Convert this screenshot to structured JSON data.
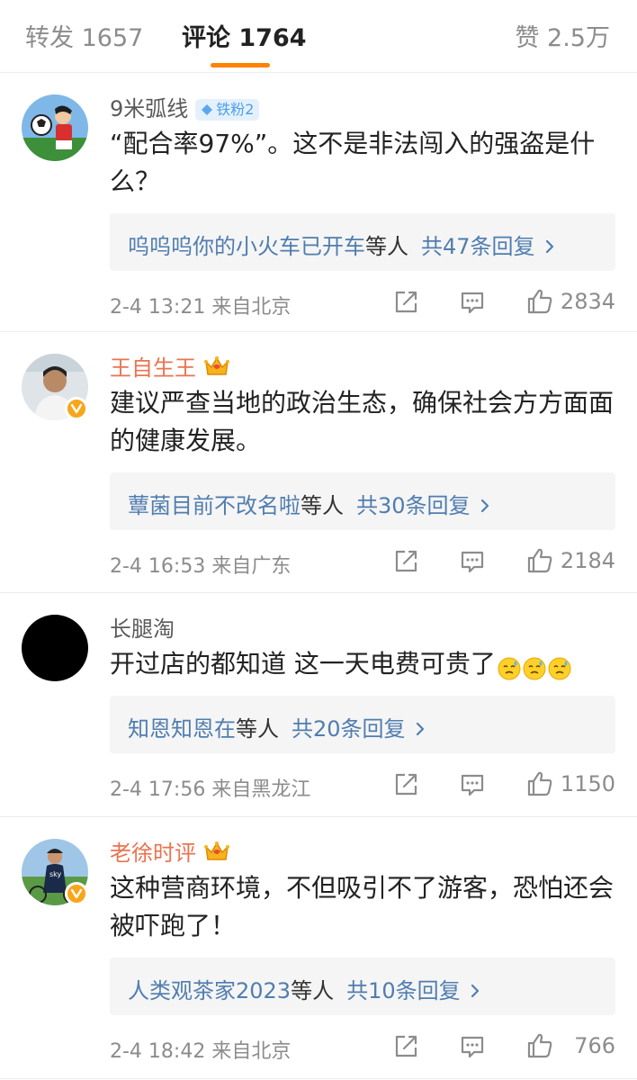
{
  "tabs": {
    "repost": "转发 1657",
    "comments": "评论 1764",
    "likes": "赞 2.5万"
  },
  "colors": {
    "accent": "#ff8200",
    "link": "#507daf",
    "vip_name": "#eb7350"
  },
  "comments": [
    {
      "user": "9米弧线",
      "fan_badge": "铁粉2",
      "text": "“配合率97%”。这不是非法闯入的强盗是什么？",
      "reply_names": "呜呜呜你的小火车已开车",
      "reply_suffix": "等人",
      "reply_count": "共47条回复",
      "meta": "2-4 13:21  来自北京",
      "likes": "2834"
    },
    {
      "user": "王自生王",
      "text": "建议严查当地的政治生态，确保社会方方面面的健康发展。",
      "reply_names": "蕈菌目前不改名啦",
      "reply_suffix": "等人",
      "reply_count": "共30条回复",
      "meta": "2-4 16:53  来自广东",
      "likes": "2184"
    },
    {
      "user": "长腿淘",
      "text": "开过店的都知道 这一天电费可贵了",
      "emojis": [
        "sweat-emoji",
        "sweat-emoji",
        "sweat-emoji"
      ],
      "reply_names": "知恩知恩在",
      "reply_suffix": "等人",
      "reply_count": "共20条回复",
      "meta": "2-4 17:56  来自黑龙江",
      "likes": "1150"
    },
    {
      "user": "老徐时评",
      "text": "这种营商环境，不但吸引不了游客，恐怕还会被吓跑了！",
      "reply_names": "人类观茶家2023",
      "reply_suffix": "等人",
      "reply_count": "共10条回复",
      "meta": "2-4 18:42  来自北京",
      "likes": "766"
    }
  ]
}
